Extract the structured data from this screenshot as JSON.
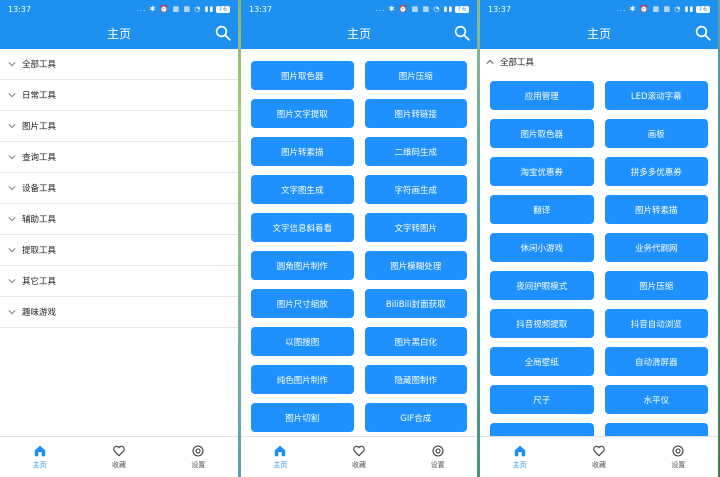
{
  "colors": {
    "primary": "#1e90f0",
    "button": "#1e90ff"
  },
  "status": {
    "time": "13:37",
    "icons": "... ✱ ⏰ ▦ ▦ ◔ ▮▮",
    "battery": "76"
  },
  "appbar": {
    "title": "主页"
  },
  "screen1": {
    "categories": [
      "全部工具",
      "日常工具",
      "图片工具",
      "查询工具",
      "设备工具",
      "辅助工具",
      "提取工具",
      "其它工具",
      "趣味游戏"
    ]
  },
  "screen2": {
    "buttons": [
      "图片取色器",
      "图片压缩",
      "图片文字提取",
      "图片转链接",
      "图片转素描",
      "二维码生成",
      "文字图生成",
      "字符画生成",
      "文字信息斜着看",
      "文字转图片",
      "圆角图片制作",
      "图片模糊处理",
      "图片尺寸缩放",
      "BiliBili封面获取",
      "以图搜图",
      "图片黑白化",
      "纯色图片制作",
      "隐藏图制作",
      "图片切割",
      "GIF合成"
    ]
  },
  "screen3": {
    "section": "全部工具",
    "buttons": [
      "应用管理",
      "LED滚动字幕",
      "图片取色器",
      "画板",
      "淘宝优惠券",
      "拼多多优惠券",
      "翻译",
      "图片转素描",
      "休闲小游戏",
      "业务代刷网",
      "夜间护眼模式",
      "图片压缩",
      "抖音视频提取",
      "抖音自动浏览",
      "全局壁纸",
      "自动滑屏器",
      "尺子",
      "水平仪",
      "",
      ""
    ]
  },
  "nav": {
    "home": "主页",
    "favorites": "收藏",
    "settings": "设置"
  }
}
